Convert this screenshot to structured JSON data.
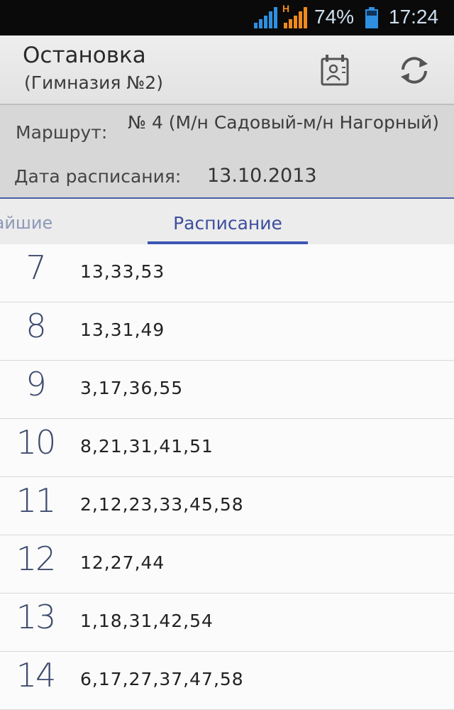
{
  "status_bar": {
    "network_type": "H",
    "battery_percent": "74%",
    "time": "17:24",
    "icons": [
      "signal-icon",
      "mobile-data-signal-icon",
      "battery-icon"
    ]
  },
  "action_bar": {
    "title": "Остановка",
    "subtitle": "(Гимназия №2)",
    "icons": [
      "schedule-card-icon",
      "refresh-icon"
    ]
  },
  "info": {
    "route_label": "Маршрут:",
    "route_value": "№ 4 (М/н Садовый-м/н Нагорный)",
    "date_label": "Дата расписания:",
    "date_value": "13.10.2013"
  },
  "tabs": [
    {
      "label": "жайшие",
      "active": false
    },
    {
      "label": "Расписание",
      "active": true
    }
  ],
  "colors": {
    "accent": "#3c57b3",
    "status_bar_bg": "#0a0a0a",
    "info_bg": "#d7d7d7"
  },
  "schedule": [
    {
      "hour": "7",
      "minutes": "13,33,53"
    },
    {
      "hour": "8",
      "minutes": "13,31,49"
    },
    {
      "hour": "9",
      "minutes": "3,17,36,55"
    },
    {
      "hour": "10",
      "minutes": "8,21,31,41,51"
    },
    {
      "hour": "11",
      "minutes": "2,12,23,33,45,58"
    },
    {
      "hour": "12",
      "minutes": "12,27,44"
    },
    {
      "hour": "13",
      "minutes": "1,18,31,42,54"
    },
    {
      "hour": "14",
      "minutes": "6,17,27,37,47,58"
    }
  ]
}
